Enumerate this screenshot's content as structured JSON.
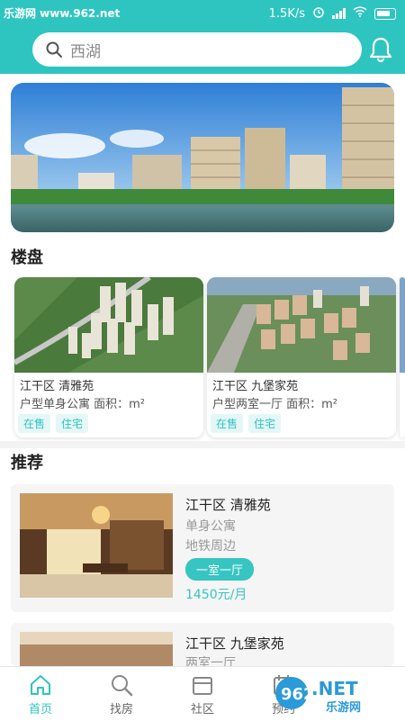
{
  "statusbar": {
    "watermark": "乐游网 www.962.net",
    "speed": "1.5K/s"
  },
  "search": {
    "placeholder": "西湖",
    "icon": "search-icon"
  },
  "header": {
    "bell_icon": "bell-icon"
  },
  "sections": {
    "listings_title": "楼盘",
    "recommend_title": "推荐"
  },
  "listings": [
    {
      "title": "江干区 清雅苑",
      "info": "户型单身公寓 面积：m²",
      "tags": [
        "在售",
        "住宅"
      ]
    },
    {
      "title": "江干区 九堡家苑",
      "info": "户型两室一厅 面积：m²",
      "tags": [
        "在售",
        "住宅"
      ]
    }
  ],
  "recommend": [
    {
      "title": "江干区 清雅苑",
      "type": "单身公寓",
      "feature": "地铁周边",
      "layout": "一室一厅",
      "price": "1450元/月"
    },
    {
      "title": "江干区 九堡家苑",
      "type": "两室一厅"
    }
  ],
  "tabbar": [
    {
      "label": "首页",
      "icon": "home-icon",
      "active": true
    },
    {
      "label": "找房",
      "icon": "search-icon"
    },
    {
      "label": "社区",
      "icon": "community-icon"
    },
    {
      "label": "预约",
      "icon": "calendar-icon"
    }
  ],
  "watermark_logo": {
    "brand": "962",
    "suffix": ".NET",
    "cn": "乐游网"
  },
  "colors": {
    "accent": "#2ec5c0",
    "tag_bg": "#e4f7f6"
  }
}
